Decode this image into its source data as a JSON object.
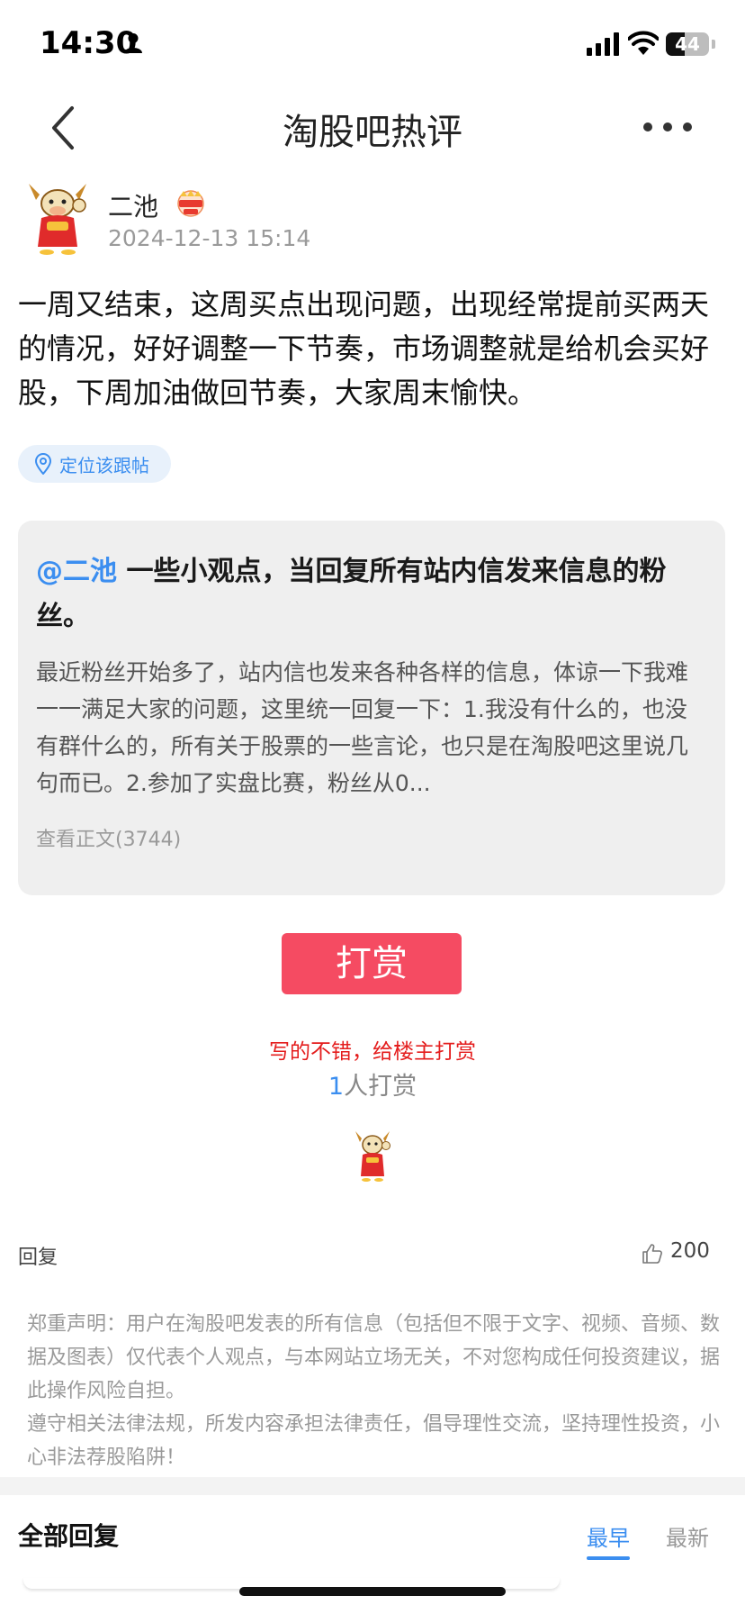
{
  "status_bar": {
    "time": "14:30",
    "battery": "44",
    "battery_level": 0.44
  },
  "nav": {
    "title": "淘股吧热评"
  },
  "post": {
    "author": "二池",
    "time": "2024-12-13 15:14",
    "body": "一周又结束，这周买点出现问题，出现经常提前买两天的情况，好好调整一下节奏，市场调整就是给机会买好股，下周加油做回节奏，大家周末愉快。",
    "locate_label": "定位该跟帖"
  },
  "quote": {
    "mention": "@二池",
    "title": "一些小观点，当回复所有站内信发来信息的粉丝。",
    "excerpt": "最近粉丝开始多了，站内信也发来各种各样的信息，体谅一下我难一一满足大家的问题，这里统一回复一下：1.我没有什么的，也没有群什么的，所有关于股票的一些言论，也只是在淘股吧这里说几句而已。2.参加了实盘比赛，粉丝从0...",
    "read_more": "查看正文(3744)"
  },
  "tip": {
    "button_label": "打赏",
    "prompt": "写的不错，给楼主打赏",
    "count": "1",
    "count_suffix": "人打赏"
  },
  "actions": {
    "reply_label": "回复",
    "like_count": "200"
  },
  "disclaimer": {
    "line1": "郑重声明：用户在淘股吧发表的所有信息（包括但不限于文字、视频、音频、数据及图表）仅代表个人观点，与本网站立场无关，不对您构成任何投资建议，据此操作风险自担。",
    "line2": "遵守相关法律法规，所发内容承担法律责任，倡导理性交流，坚持理性投资，小心非法荐股陷阱！"
  },
  "replies": {
    "header": "全部回复",
    "sort_early": "最早",
    "sort_latest": "最新"
  },
  "colors": {
    "accent": "#3b8ef0",
    "tip_button": "#f54b62",
    "tip_prompt": "#e41d1d"
  }
}
